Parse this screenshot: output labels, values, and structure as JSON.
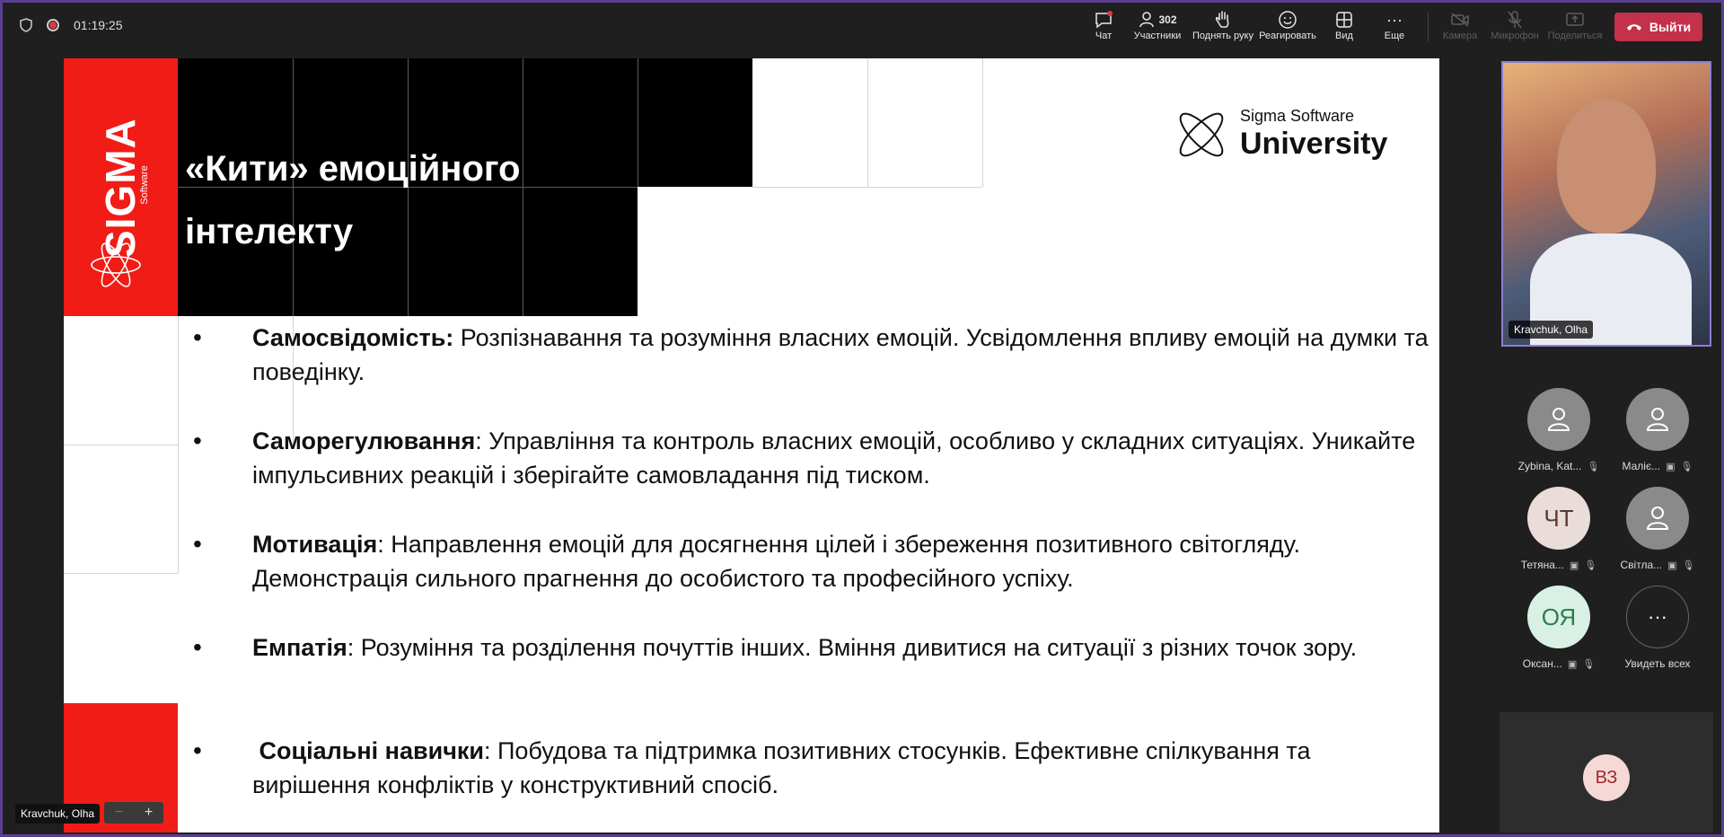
{
  "topbar": {
    "timer": "01:19:25",
    "chat_label": "Чат",
    "participants_count": "302",
    "participants_label": "Участники",
    "raise_hand_label": "Поднять руку",
    "react_label": "Реагировать",
    "view_label": "Вид",
    "more_label": "Еще",
    "camera_label": "Камера",
    "mic_label": "Микрофон",
    "share_label": "Поделиться",
    "leave_label": "Выйти"
  },
  "slide": {
    "title_line1": "«Кити» емоційного",
    "title_line2": "інтелекту",
    "logo_brand": "SIGMA",
    "logo_sub": "Software",
    "university_line1": "Sigma Software",
    "university_line2": "University",
    "bullets": [
      {
        "term": "Самосвідомість:",
        "text": " Розпізнавання та розуміння власних емоцій. Усвідомлення впливу емоцій на думки та поведінку."
      },
      {
        "term": "Саморегулювання",
        "text": ": Управління та контроль власних емоцій, особливо у складних ситуаціях. Уникайте імпульсивних реакцій і зберігайте самовладання під тиском."
      },
      {
        "term": "Мотивація",
        "text": ": Направлення емоцій для досягнення цілей і збереження позитивного світогляду. Демонстрація сильного прагнення до особистого та професійного успіху."
      },
      {
        "term": "Емпатія",
        "text": ": Розуміння та розділення почуттів інших. Вміння дивитися на ситуації з різних точок зору."
      },
      {
        "term": " Соціальні навички",
        "text": ": Побудова та підтримка позитивних стосунків. Ефективне спілкування та вирішення конфліктів у конструктивний спосіб."
      }
    ]
  },
  "presenter": {
    "name": "Kravchuk, Olha"
  },
  "video": {
    "name": "Kravchuk, Olha"
  },
  "participants": [
    {
      "name": "Zybina, Kat...",
      "initials": "",
      "bg": "#8a8a8a",
      "fg": "#ffffff"
    },
    {
      "name": "Маліє...",
      "initials": "",
      "bg": "#8a8a8a",
      "fg": "#ffffff"
    },
    {
      "name": "Тетяна...",
      "initials": "ЧТ",
      "bg": "#eadcd8",
      "fg": "#5a3a33"
    },
    {
      "name": "Світла...",
      "initials": "",
      "bg": "#8a8a8a",
      "fg": "#ffffff"
    },
    {
      "name": "Оксан...",
      "initials": "ОЯ",
      "bg": "#d9f1e4",
      "fg": "#2e7d4f"
    }
  ],
  "see_all": {
    "label": "Увидеть всех"
  },
  "self": {
    "initials": "ВЗ"
  }
}
